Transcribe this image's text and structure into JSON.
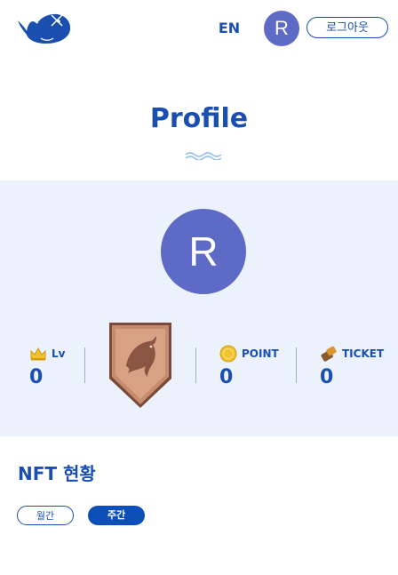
{
  "header": {
    "lang_label": "EN",
    "avatar_initial": "R",
    "logout_label": "로그아웃"
  },
  "title": "Profile",
  "profile": {
    "avatar_initial": "R",
    "stats": {
      "level": {
        "label": "Lv",
        "value": "0",
        "icon": "crown-icon"
      },
      "point": {
        "label": "POINT",
        "value": "0",
        "icon": "coin-icon"
      },
      "ticket": {
        "label": "TICKET",
        "value": "0",
        "icon": "ticket-icon"
      }
    },
    "badge": {
      "icon": "dolphin-badge-icon",
      "tier_color": "#b87a5e"
    }
  },
  "nft": {
    "title": "NFT 현황",
    "tabs": [
      {
        "label": "월간",
        "active": false
      },
      {
        "label": "주간",
        "active": true
      }
    ]
  },
  "colors": {
    "brand": "#1a4fb0",
    "avatar": "#5d6ac6",
    "panel_bg": "#ebf2fc"
  }
}
